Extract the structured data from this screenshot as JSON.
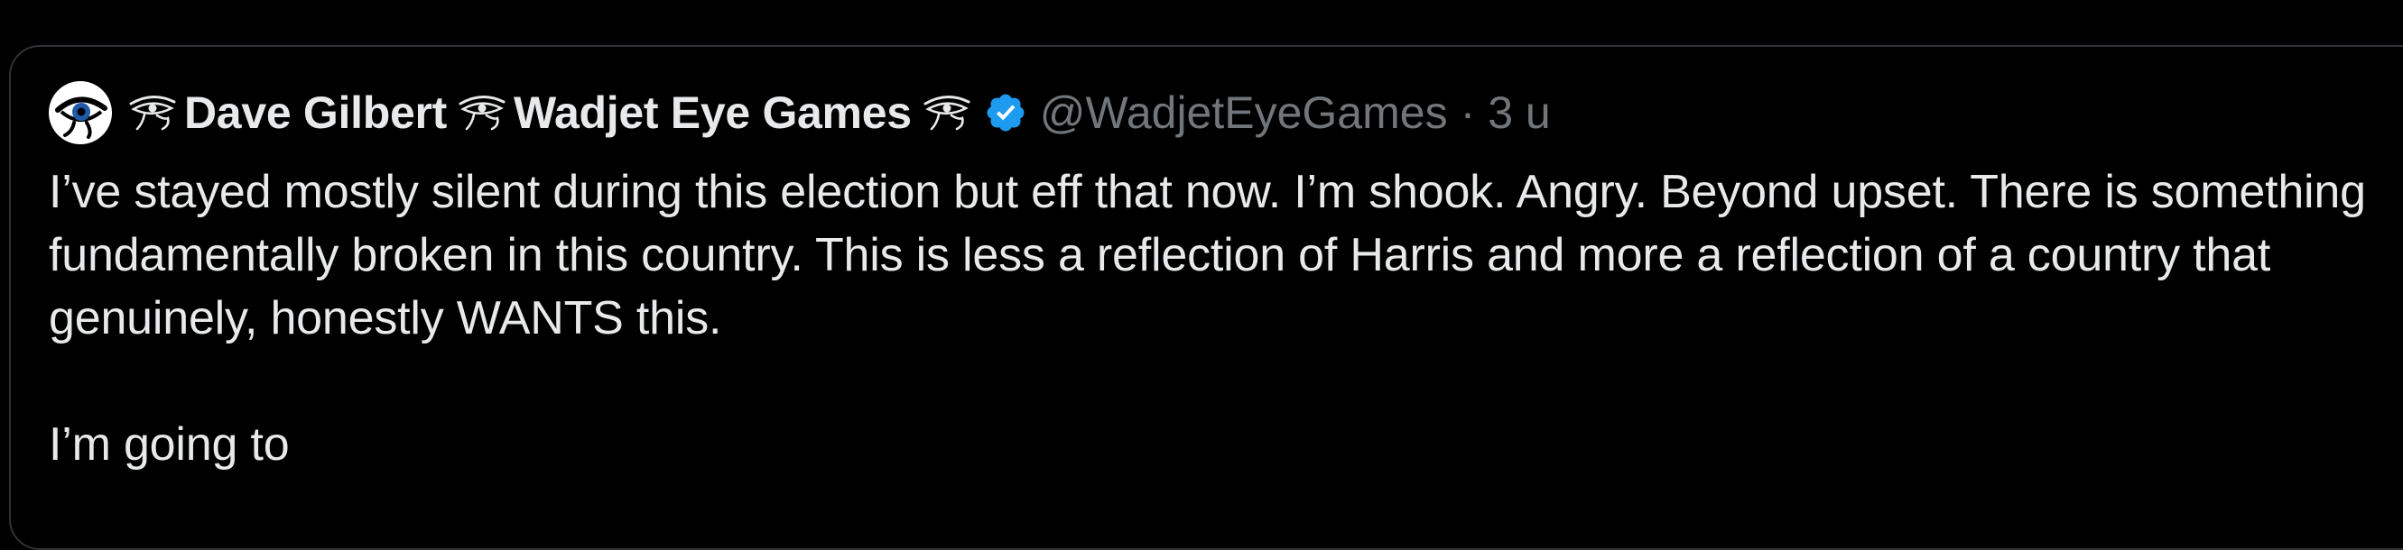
{
  "tweet": {
    "author": {
      "name_part1": "Dave Gilbert",
      "name_part2": "Wadjet Eye Games",
      "handle": "@WadjetEyeGames",
      "separator": "·",
      "time": "3 u",
      "avatar_icon": "eye-of-horus-avatar",
      "verified_icon": "verified-badge",
      "name_emoji_icon": "eye-of-horus-glyph"
    },
    "body": {
      "paragraph1": "I’ve stayed mostly silent during this election but eff that now. I’m shook. Angry. Beyond upset. There is something fundamentally broken in this country.  This is less a reflection of Harris and more a reflection of a country that genuinely, honestly WANTS this.",
      "paragraph2": "I’m going to"
    }
  },
  "colors": {
    "background": "#000000",
    "border": "#2f3336",
    "primary_text": "#e7e9ea",
    "secondary_text": "#71767b",
    "verified": "#1d9bf0"
  }
}
